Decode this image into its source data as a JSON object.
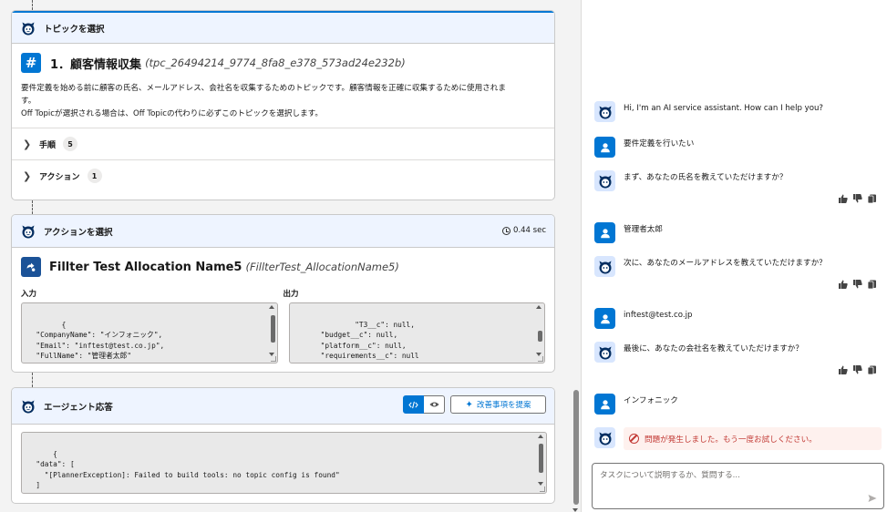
{
  "topic_card": {
    "header_title": "トピックを選択",
    "topic_number": "1．",
    "topic_name": "顧客情報収集",
    "topic_api_name": "(tpc_26494214_9774_8fa8_e378_573ad24e232b)",
    "hash_symbol": "#",
    "description_line1": "要件定義を始める前に顧客の氏名、メールアドレス、会社名を収集するためのトピックです。顧客情報を正確に収集するために使用されま",
    "description_line2": "す。",
    "description_line3": "Off Topicが選択される場合は、Off Topicの代わりに必ずこのトピックを選択します。",
    "sections": [
      {
        "label": "手順",
        "count": "5"
      },
      {
        "label": "アクション",
        "count": "1"
      }
    ]
  },
  "action_card": {
    "header_title": "アクションを選択",
    "elapsed": "0.44 sec",
    "action_name": "Fillter Test Allocation Name5",
    "action_api_name": "(FillterTest_AllocationName5)",
    "input_label": "入力",
    "output_label": "出力",
    "input_code": "{\n  \"CompanyName\": \"インフォニック\",\n  \"Email\": \"inftest@test.co.jp\",\n  \"FullName\": \"管理者太郎\"\n}",
    "output_code": "      \"T3__c\": null,\n      \"budget__c\": null,\n      \"platform__c\": null,\n      \"requirements__c\": null\n    }\n  }"
  },
  "response_card": {
    "header_title": "エージェント応答",
    "code_toggle_icon": "code-icon",
    "preview_toggle_icon": "eye-icon",
    "suggest_button": "改善事項を提案",
    "response_code": "{\n  \"data\": [\n    \"[PlannerException]: Failed to build tools: no topic config is found\"\n  ]\n}"
  },
  "chat": {
    "messages": [
      {
        "role": "bot",
        "text": "Hi, I'm an AI service assistant. How can I help you?",
        "feedback": false
      },
      {
        "role": "user",
        "text": "要件定義を行いたい"
      },
      {
        "role": "bot",
        "text": "まず、あなたの氏名を教えていただけますか？",
        "feedback": true
      },
      {
        "role": "user",
        "text": "管理者太郎"
      },
      {
        "role": "bot",
        "text": "次に、あなたのメールアドレスを教えていただけますか？",
        "feedback": true
      },
      {
        "role": "user",
        "text": "inftest@test.co.jp"
      },
      {
        "role": "bot",
        "text": "最後に、あなたの会社名を教えていただけますか？",
        "feedback": true
      },
      {
        "role": "user",
        "text": "インフォニック"
      }
    ],
    "error_text": "問題が発生しました。もう一度お試しください。",
    "input_placeholder": "タスクについて説明するか、質問する...",
    "colors": {
      "accent": "#0176d3",
      "error": "#c23934",
      "error_bg": "#fef1ee",
      "header_bg": "#eef4ff"
    }
  }
}
